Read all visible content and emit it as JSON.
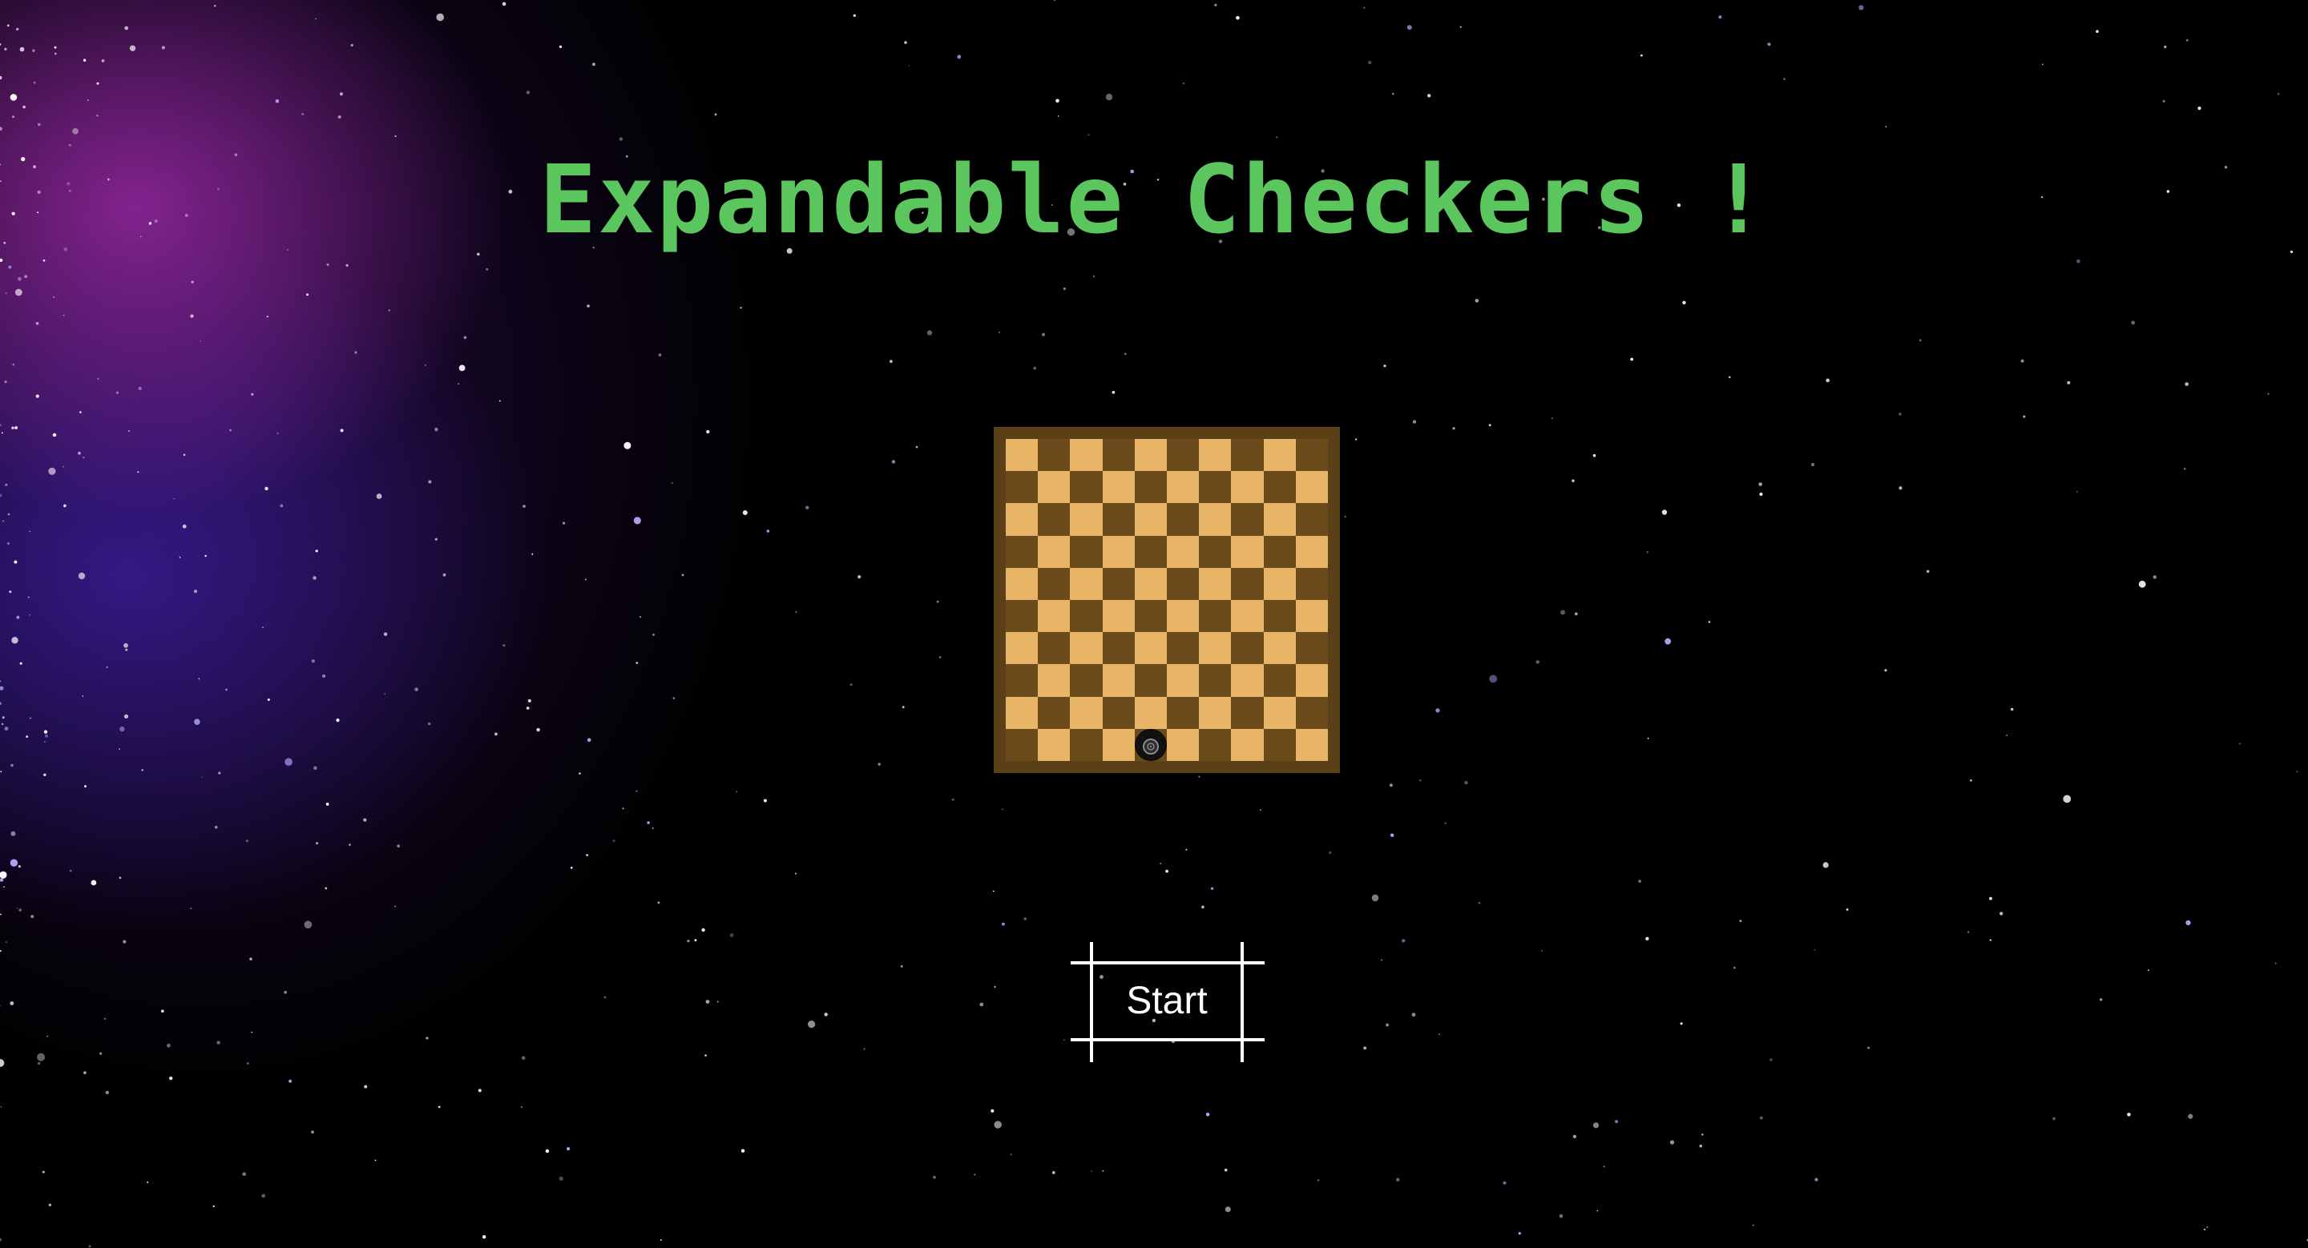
{
  "game": {
    "title": "Expandable Checkers !",
    "start_label": "Start"
  },
  "board": {
    "rows": 10,
    "cols": 10,
    "light_color": "#e8b566",
    "dark_color": "#6b4a1c",
    "frame_color": "#5a3f17",
    "pieces": [
      {
        "row": 9,
        "col": 4,
        "color": "black",
        "icon": "target-icon"
      }
    ]
  },
  "theme": {
    "title_color": "#5cc65e",
    "button_color": "#ffffff",
    "background": "starfield"
  }
}
